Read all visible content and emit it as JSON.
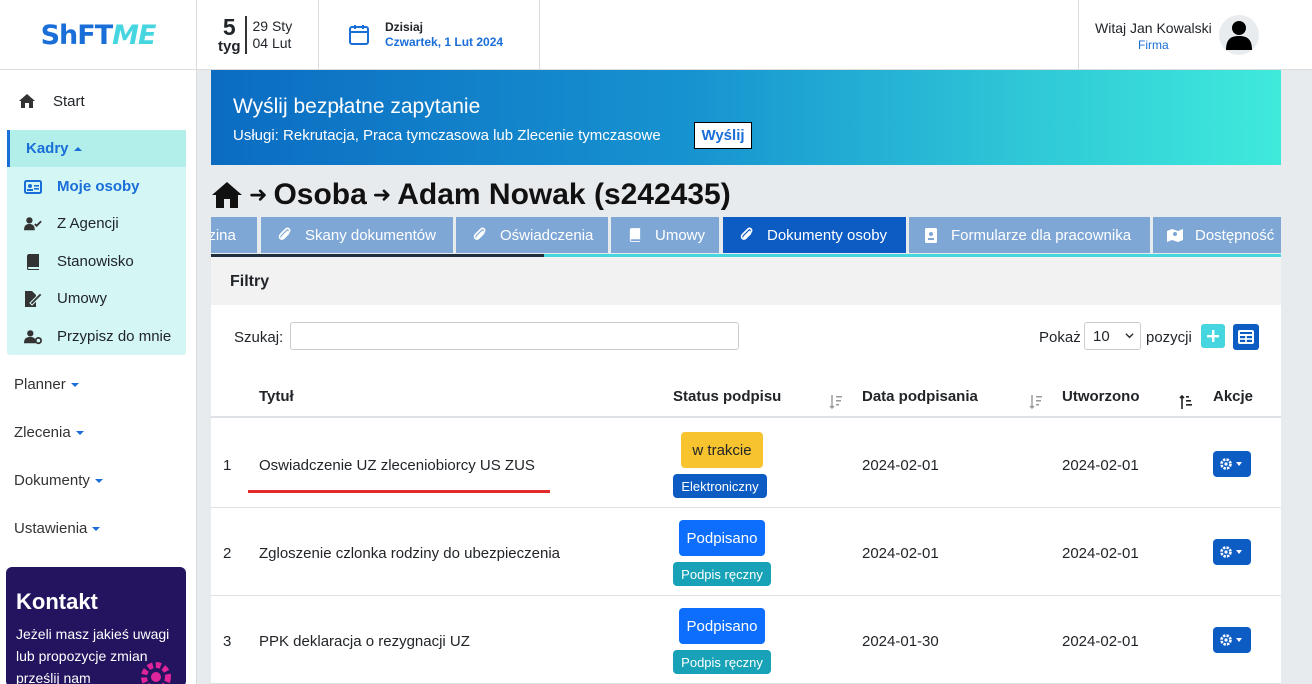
{
  "header": {
    "logo_part1": "ShFT",
    "logo_part2": "ME",
    "week_number": "5",
    "week_label": "tyg",
    "week_start": "29 Sty",
    "week_end": "04 Lut",
    "today_label": "Dzisiaj",
    "today_value": "Czwartek, 1 Lut 2024",
    "greeting": "Witaj Jan Kowalski",
    "role": "Firma"
  },
  "sidebar": {
    "start": "Start",
    "kadry": "Kadry",
    "kadry_items": [
      {
        "label": "Moje osoby",
        "icon": "id-card-icon"
      },
      {
        "label": "Z Agencji",
        "icon": "user-check-icon"
      },
      {
        "label": "Stanowisko",
        "icon": "book-icon"
      },
      {
        "label": "Umowy",
        "icon": "file-signature-icon"
      },
      {
        "label": "Przypisz do mnie",
        "icon": "user-gear-icon"
      }
    ],
    "menus": [
      "Planner",
      "Zlecenia",
      "Dokumenty",
      "Ustawienia"
    ],
    "contact_title": "Kontakt",
    "contact_text": "Jeżeli masz jakieś uwagi lub propozycje zmian prześlij nam"
  },
  "banner": {
    "title": "Wyślij bezpłatne zapytanie",
    "subtitle": "Usługi: Rekrutacja, Praca tymczasowa lub Zlecenie tymczasowe",
    "button": "Wyślij"
  },
  "breadcrumb": {
    "level1": "Osoba",
    "level2": "Adam Nowak (s242435)"
  },
  "tabs": [
    {
      "label": "dzina",
      "icon": ""
    },
    {
      "label": "Skany dokumentów",
      "icon": "paperclip-icon"
    },
    {
      "label": "Oświadczenia",
      "icon": "paperclip-icon"
    },
    {
      "label": "Umowy",
      "icon": "book-icon"
    },
    {
      "label": "Dokumenty osoby",
      "icon": "paperclip-icon"
    },
    {
      "label": "Formularze dla pracownika",
      "icon": "id-badge-icon"
    },
    {
      "label": "Dostępność",
      "icon": "map-icon"
    }
  ],
  "filters": {
    "title": "Filtry",
    "search_label": "Szukaj:",
    "search_value": "",
    "show_label": "Pokaż",
    "show_value": "10",
    "show_suffix": "pozycji"
  },
  "table": {
    "columns": [
      "Tytuł",
      "Status podpisu",
      "Data podpisania",
      "Utworzono",
      "Akcje"
    ],
    "rows": [
      {
        "index": "1",
        "title": "Oswiadczenie UZ zleceniobiorcy US ZUS",
        "status": "w trakcie",
        "method": "Elektroniczny",
        "signed": "2024-02-01",
        "created": "2024-02-01"
      },
      {
        "index": "2",
        "title": "Zgloszenie czlonka rodziny do ubezpieczenia",
        "status": "Podpisano",
        "method": "Podpis ręczny",
        "signed": "2024-02-01",
        "created": "2024-02-01"
      },
      {
        "index": "3",
        "title": "PPK deklaracja o rezygnacji UZ",
        "status": "Podpisano",
        "method": "Podpis ręczny",
        "signed": "2024-01-30",
        "created": "2024-02-01"
      }
    ]
  },
  "colors": {
    "primary": "#0c5cc4",
    "accent_teal": "#46d6e0",
    "status_in_progress": "#f7c32e",
    "status_signed": "#0d6efd",
    "method_electronic": "#0c5cc4",
    "method_manual": "#17a2b8",
    "highlight_underline": "#e32a2a"
  }
}
